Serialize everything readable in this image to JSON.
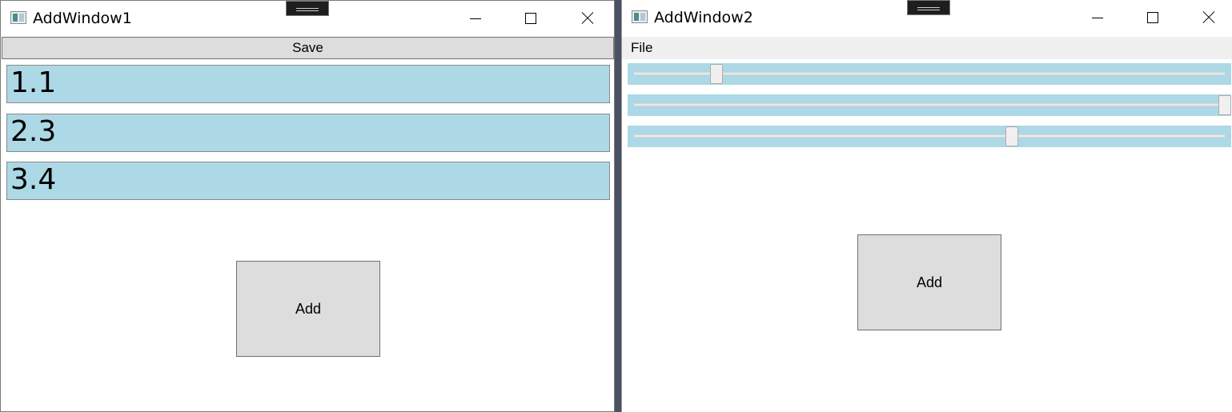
{
  "window1": {
    "title": "AddWindow1",
    "save_label": "Save",
    "values": [
      "1.1",
      "2.3",
      "3.4"
    ],
    "add_label": "Add"
  },
  "window2": {
    "title": "AddWindow2",
    "menu_file": "File",
    "sliders": [
      {
        "value_fraction": 0.14
      },
      {
        "value_fraction": 1.0
      },
      {
        "value_fraction": 0.64
      }
    ],
    "add_label": "Add"
  },
  "colors": {
    "field_background": "#add8e6",
    "button_background": "#dddddd"
  }
}
